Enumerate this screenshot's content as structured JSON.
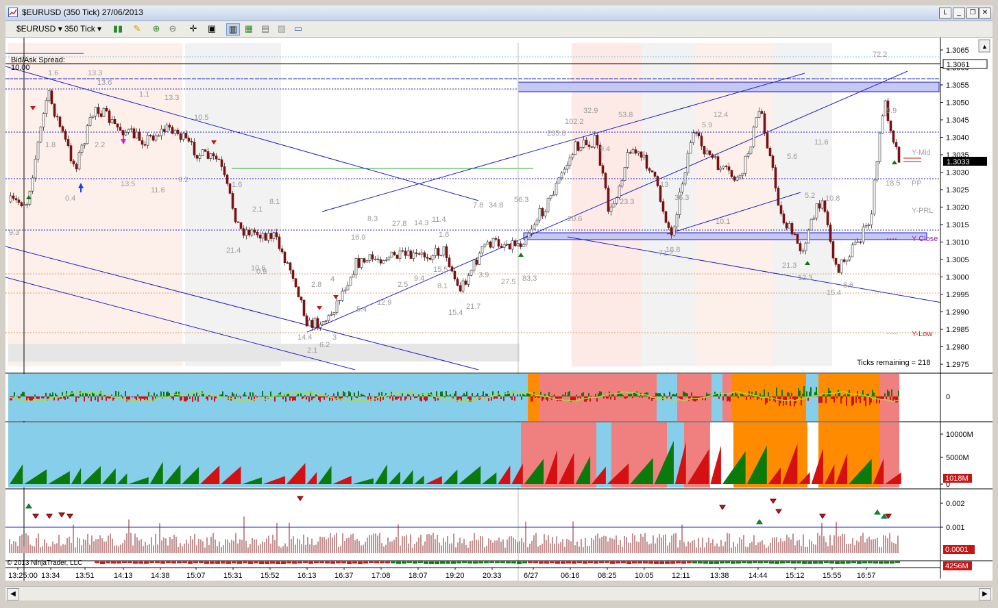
{
  "window": {
    "title": "$EURUSD (350 Tick)  27/06/2013",
    "btn_l": "L",
    "btn_min": "_",
    "btn_restore": "❐",
    "btn_close": "✕"
  },
  "toolbar": {
    "instrument": "$EURUSD",
    "interval": "350 Tick"
  },
  "chart": {
    "bidask_label": "Bid/Ask Spread:",
    "bidask_value": "10.00",
    "ticks_remaining": "Ticks remaining = 218",
    "copyright": "© 2013 NinjaTrader, LLC",
    "price_ticks": [
      "1.3065",
      "1.3060",
      "1.3055",
      "1.3050",
      "1.3045",
      "1.3040",
      "1.3035",
      "1.3030",
      "1.3025",
      "1.3020",
      "1.3015",
      "1.3010",
      "1.3005",
      "1.3000",
      "1.2995",
      "1.2990",
      "1.2985",
      "1.2980",
      "1.2975"
    ],
    "price_marker": "1.3061",
    "last_price": "1.3033",
    "level_labels": {
      "ymid": "Y-Mid",
      "pp": "PP",
      "yprl": "Y-PRL",
      "yclose": "Y Close",
      "ylow": "Y-Low"
    },
    "time_ticks": [
      "13:25:00",
      "13:34",
      "13:51",
      "14:13",
      "14:38",
      "15:07",
      "15:31",
      "15:52",
      "16:13",
      "16:37",
      "17:08",
      "18:07",
      "19:20",
      "20:33",
      "6/27",
      "06:16",
      "08:25",
      "10:05",
      "12:11",
      "13:38",
      "14:44",
      "15:12",
      "15:55",
      "16:57"
    ],
    "number_labels": [
      "1.6",
      "13.3",
      "13.6",
      "1.1",
      "13.3",
      "10.5",
      "1.8",
      "2.2",
      "13.5",
      "11.6",
      "9.2",
      "1.6",
      "2.1",
      "8.1",
      "21.4",
      "10.6",
      "0.9",
      "8.3",
      "16.9",
      "27.8",
      "14.3",
      "11.4",
      "1.6",
      "2.8",
      "4",
      "5.4",
      "12.9",
      "2.5",
      "9.4",
      "15.5",
      "8.1",
      "15.4",
      "21.7",
      "7.8",
      "34.8",
      "56.3",
      "27.5",
      "83.3",
      "3.9",
      "235.8",
      "102.2",
      "32.9",
      "53.8",
      "9.4",
      "20.6",
      "23.3",
      "13",
      "36.3",
      "10.1",
      "71.2",
      "16.8",
      "12.4",
      "5.9",
      "5.6",
      "11.6",
      "5.2",
      "10.8",
      "21.3",
      "12.3",
      "15.4",
      "8.6",
      "72.2",
      "9.9",
      "18.5",
      "14.4",
      "6.2",
      "3",
      "2.1",
      "0.4",
      "9.3"
    ]
  },
  "panel1": {
    "zero": "0"
  },
  "panel2": {
    "tick_10000": "10000M",
    "tick_5000": "5000M",
    "tick_0": "0",
    "last": "1018M"
  },
  "panel3": {
    "tick_002": "0.002",
    "tick_001": "0.001",
    "last": "0.0001"
  },
  "panel4": {
    "last": "4256M"
  },
  "colors": {
    "up": "#0a7a0a",
    "down": "#d40000",
    "channel": "#1f1fc8",
    "blue_bg": "#87ceeb",
    "salmon_bg": "#f08080",
    "orange_bg": "#ff8c00"
  }
}
